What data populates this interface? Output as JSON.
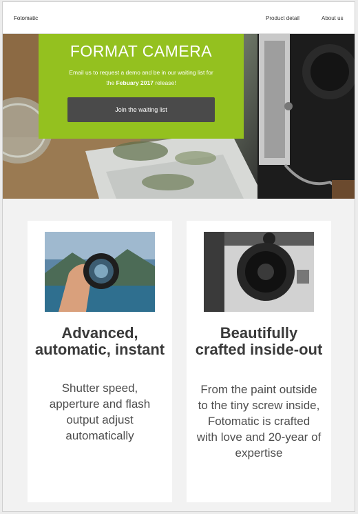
{
  "header": {
    "brand": "Fotomatic",
    "nav": [
      {
        "label": "Product detail"
      },
      {
        "label": "About us"
      }
    ]
  },
  "hero": {
    "title": "FORMAT CAMERA",
    "text_before": "Email us to request a demo and be in our waiting list for the ",
    "text_bold": "Febuary 2017",
    "text_after": " release!",
    "cta_label": "Join the waiting list",
    "accent_color": "#94c11f",
    "button_color": "#4a4a4a"
  },
  "features": [
    {
      "image_icon": "hand-holding-lens-image",
      "title": "Advanced, automatic, instant",
      "body": "Shutter speed, apperture and flash output adjust automatically"
    },
    {
      "image_icon": "camera-lens-closeup-image",
      "title": "Beautifully crafted inside-out",
      "body": "From the paint outside to the tiny screw inside, Fotomatic is crafted with love and 20-year of expertise"
    }
  ]
}
